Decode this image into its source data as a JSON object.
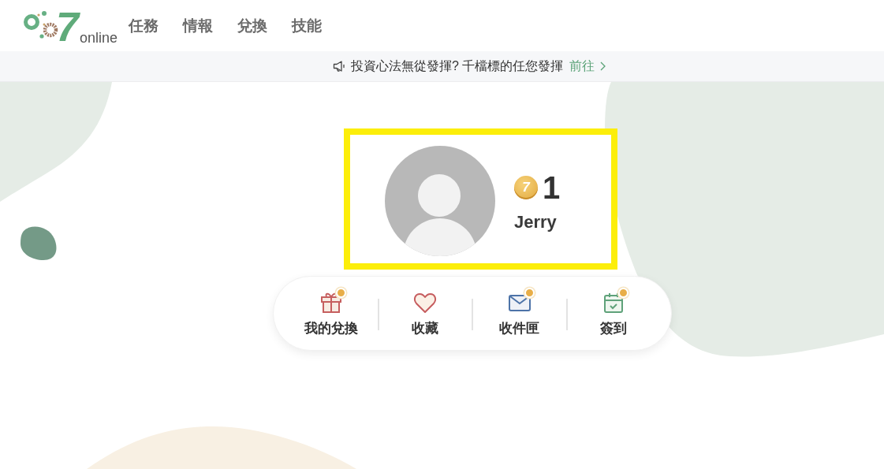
{
  "header": {
    "logo": {
      "mark": "7",
      "wordmark": "online"
    },
    "nav": [
      {
        "label": "任務"
      },
      {
        "label": "情報"
      },
      {
        "label": "兌換"
      },
      {
        "label": "技能"
      }
    ]
  },
  "notice": {
    "text": "投資心法無從發揮? 千檔標的任您發揮",
    "link": "前往"
  },
  "profile": {
    "coin_mark": "7",
    "points": "1",
    "name": "Jerry"
  },
  "actions": [
    {
      "kind": "exchange",
      "label": "我的兌換",
      "badge": true
    },
    {
      "kind": "favorites",
      "label": "收藏",
      "badge": false
    },
    {
      "kind": "inbox",
      "label": "收件匣",
      "badge": true
    },
    {
      "kind": "checkin",
      "label": "簽到",
      "badge": true
    }
  ]
}
